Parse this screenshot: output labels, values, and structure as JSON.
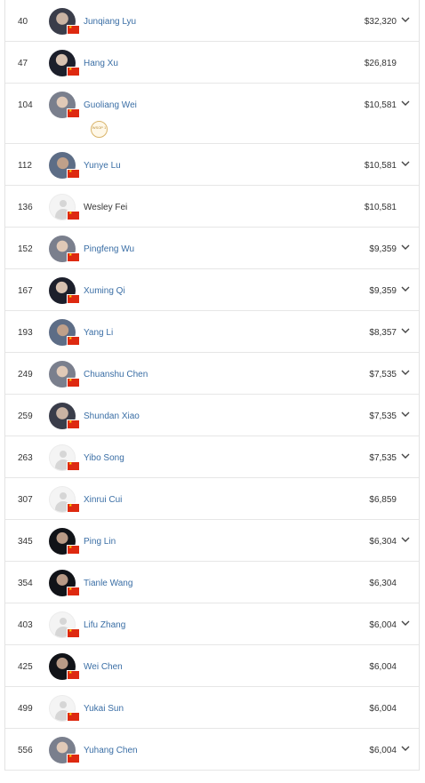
{
  "rows": [
    {
      "rank": "40",
      "name": "Junqiang Lyu",
      "amount": "$32,320",
      "avatar": "photo",
      "expandable": true
    },
    {
      "rank": "47",
      "name": "Hang Xu",
      "amount": "$26,819",
      "avatar": "photo",
      "expandable": false
    },
    {
      "rank": "104",
      "name": "Guoliang Wei",
      "amount": "$10,581",
      "avatar": "photo",
      "expandable": true,
      "badge": "WSOP 1"
    },
    {
      "rank": "112",
      "name": "Yunye Lu",
      "amount": "$10,581",
      "avatar": "photo",
      "expandable": true
    },
    {
      "rank": "136",
      "name": "Wesley Fei",
      "amount": "$10,581",
      "avatar": "placeholder",
      "expandable": false
    },
    {
      "rank": "152",
      "name": "Pingfeng Wu",
      "amount": "$9,359",
      "avatar": "photo",
      "expandable": true
    },
    {
      "rank": "167",
      "name": "Xuming Qi",
      "amount": "$9,359",
      "avatar": "photo",
      "expandable": true
    },
    {
      "rank": "193",
      "name": "Yang Li",
      "amount": "$8,357",
      "avatar": "photo",
      "expandable": true
    },
    {
      "rank": "249",
      "name": "Chuanshu Chen",
      "amount": "$7,535",
      "avatar": "photo",
      "expandable": true
    },
    {
      "rank": "259",
      "name": "Shundan Xiao",
      "amount": "$7,535",
      "avatar": "photo",
      "expandable": true
    },
    {
      "rank": "263",
      "name": "Yibo Song",
      "amount": "$7,535",
      "avatar": "placeholder",
      "expandable": true
    },
    {
      "rank": "307",
      "name": "Xinrui Cui",
      "amount": "$6,859",
      "avatar": "placeholder",
      "expandable": false
    },
    {
      "rank": "345",
      "name": "Ping Lin",
      "amount": "$6,304",
      "avatar": "photo",
      "expandable": true
    },
    {
      "rank": "354",
      "name": "Tianle Wang",
      "amount": "$6,304",
      "avatar": "photo",
      "expandable": false
    },
    {
      "rank": "403",
      "name": "Lifu Zhang",
      "amount": "$6,004",
      "avatar": "placeholder",
      "expandable": true
    },
    {
      "rank": "425",
      "name": "Wei Chen",
      "amount": "$6,004",
      "avatar": "photo",
      "expandable": false
    },
    {
      "rank": "499",
      "name": "Yukai Sun",
      "amount": "$6,004",
      "avatar": "placeholder",
      "expandable": false
    },
    {
      "rank": "556",
      "name": "Yuhang Chen",
      "amount": "$6,004",
      "avatar": "photo",
      "expandable": true
    }
  ],
  "icons": {
    "flag": "china-flag-icon",
    "chevron": "chevron-down-icon",
    "placeholder": "user-placeholder-icon"
  },
  "colors": {
    "link": "#3a6ea5",
    "flag_red": "#de2910",
    "flag_star": "#ffde00"
  }
}
